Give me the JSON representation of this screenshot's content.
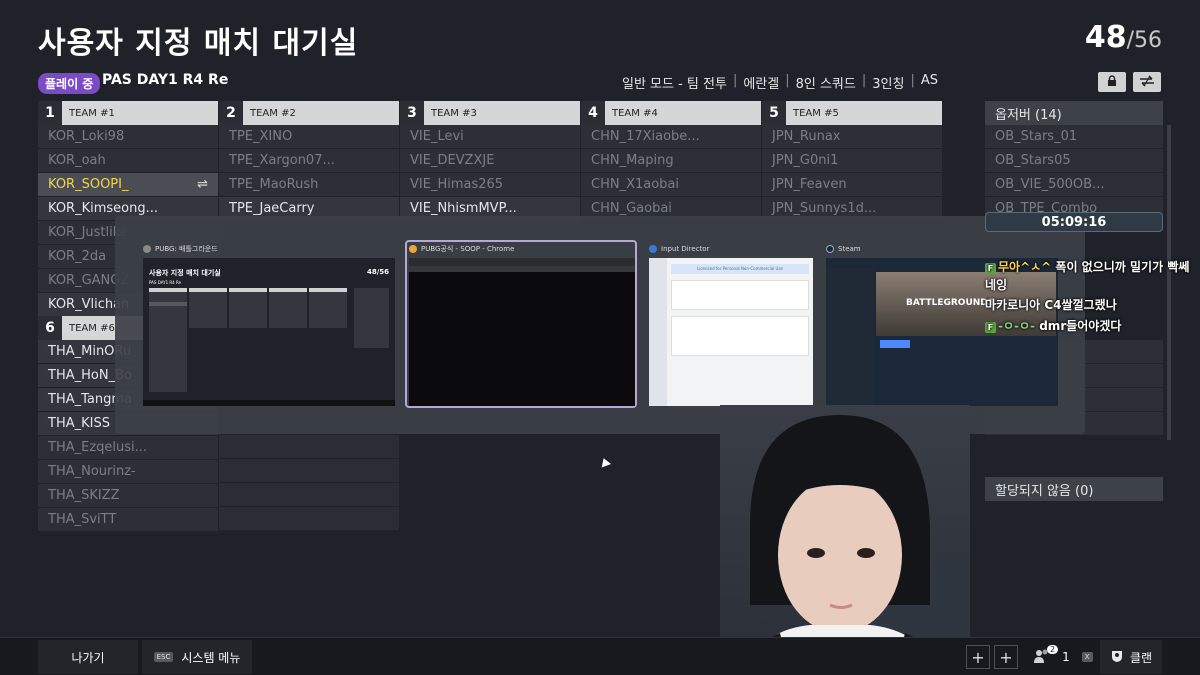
{
  "header": {
    "title": "사용자 지정 매치 대기실",
    "count_current": "48",
    "count_total": "/56",
    "status_badge": "플레이 중",
    "match_name": "PAS DAY1 R4 Re",
    "settings": [
      "일반 모드 - 팀 전투",
      "에란겔",
      "8인 스쿼드",
      "3인칭",
      "AS"
    ],
    "lock_icon": "lock-icon",
    "swap_toggle_icon": "swap-icon"
  },
  "teams": [
    {
      "num": "1",
      "name": "TEAM #1",
      "players": [
        "KOR_Loki98",
        "KOR_oah",
        "KOR_SOOPI_",
        "KOR_Kimseong...",
        "KOR_Justlike",
        "KOR_2da",
        "KOR_GANGZ",
        "KOR_Vlichan"
      ]
    },
    {
      "num": "2",
      "name": "TEAM #2",
      "players": [
        "TPE_XINO",
        "TPE_Xargon07...",
        "TPE_MaoRush",
        "TPE_JaeCarry"
      ]
    },
    {
      "num": "3",
      "name": "TEAM #3",
      "players": [
        "VIE_Levi",
        "VIE_DEVZXJE",
        "VIE_Himas265",
        "VIE_NhismMVP..."
      ]
    },
    {
      "num": "4",
      "name": "TEAM #4",
      "players": [
        "CHN_17Xiaobe...",
        "CHN_Maping",
        "CHN_X1aobai",
        "CHN_Gaobai"
      ]
    },
    {
      "num": "5",
      "name": "TEAM #5",
      "players": [
        "JPN_Runax",
        "JPN_G0ni1",
        "JPN_Feaven",
        "JPN_Sunnys1d..."
      ]
    },
    {
      "num": "6",
      "name": "TEAM #6",
      "players": [
        "THA_MinORu",
        "THA_HoN_Bo",
        "THA_Tangma",
        "THA_KISS",
        "THA_Ezqelusi...",
        "THA_Nourinz-",
        "THA_SKIZZ",
        "THA_SviTT"
      ]
    }
  ],
  "observers": {
    "header": "옵저버 (14)",
    "items": [
      "OB_Stars_01",
      "OB_Stars05",
      "OB_VIE_500OB...",
      "OB_TPE_Combo"
    ]
  },
  "unassigned": "할당되지 않음 (0)",
  "switcher": {
    "windows": [
      {
        "title": "PUBG: 배틀그라운드",
        "accent": "#4a4f56"
      },
      {
        "title": "PUBG공식 - SOOP - Chrome",
        "accent": "#e8a93a"
      },
      {
        "title": "Input Director",
        "accent": "#3a7ad1"
      },
      {
        "title": "Steam",
        "accent": "#1b2838"
      }
    ],
    "pubg_mini_title": "사용자 지정 매치 대기실",
    "pubg_mini_count": "48/56",
    "pubg_mini_match": "PAS DAY1 R4 Re",
    "input_director_banner": "Licensed for Personal Non-Commercial Use",
    "steam_game_name": "BATTLEGROUNDS"
  },
  "overlay": {
    "clock": "05:09:16",
    "chat": [
      {
        "nick": "무아^ㅅ^",
        "msg": "폭이 없으니까 밀기가 빡쎄"
      },
      {
        "nick": "",
        "msg": "네잉"
      },
      {
        "nick": "",
        "msg": "마카로니아 C4쌀껄그랬나"
      },
      {
        "nick": "-ㅇ-ㅇ-",
        "msg": "dmr들어야겠다"
      }
    ]
  },
  "footer": {
    "leave": "나가기",
    "esc_key": "ESC",
    "system_menu": "시스템 메뉴",
    "clan": "클랜",
    "party_count": "1",
    "party_badge": "2",
    "x_key": "X"
  },
  "colors": {
    "accent_badge": "#7b4bc7",
    "self_highlight": "#f2d54a"
  }
}
